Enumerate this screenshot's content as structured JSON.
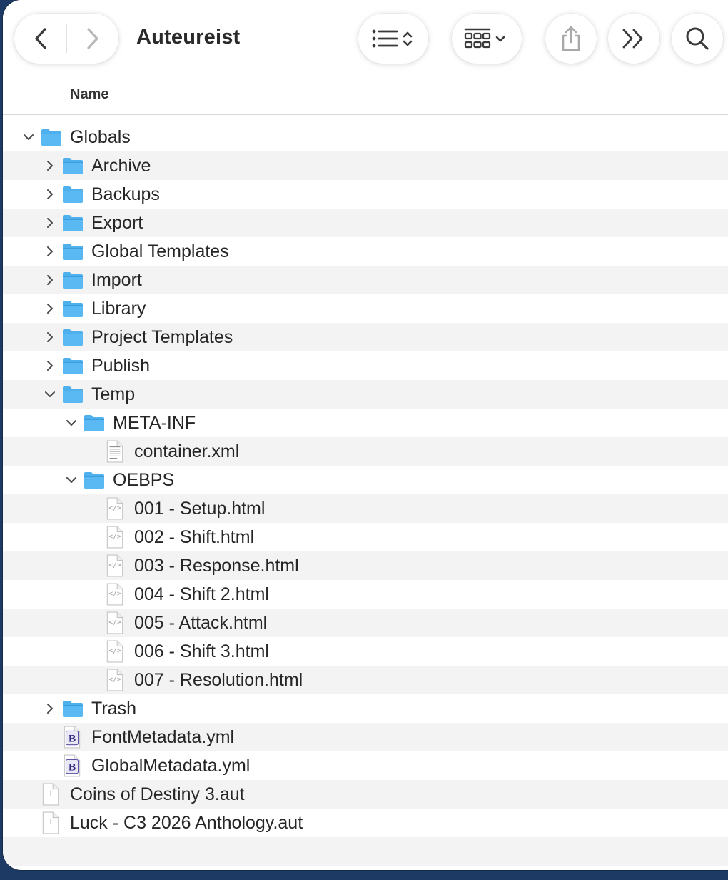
{
  "window": {
    "title": "Auteureist",
    "accent_folder": "#4fb0ee"
  },
  "toolbar": {
    "back_icon": "chevron-left-icon",
    "forward_icon": "chevron-right-icon",
    "view_icon": "list-view-icon",
    "group_icon": "grid-group-icon",
    "share_icon": "share-icon",
    "more_icon": "double-chevron-right-icon",
    "search_icon": "search-icon"
  },
  "columns": {
    "name": "Name"
  },
  "rows": [
    {
      "name": "Globals",
      "depth": 0,
      "kind": "folder",
      "expanded": true
    },
    {
      "name": "Archive",
      "depth": 1,
      "kind": "folder",
      "expanded": false
    },
    {
      "name": "Backups",
      "depth": 1,
      "kind": "folder",
      "expanded": false
    },
    {
      "name": "Export",
      "depth": 1,
      "kind": "folder",
      "expanded": false
    },
    {
      "name": "Global Templates",
      "depth": 1,
      "kind": "folder",
      "expanded": false
    },
    {
      "name": "Import",
      "depth": 1,
      "kind": "folder",
      "expanded": false
    },
    {
      "name": "Library",
      "depth": 1,
      "kind": "folder",
      "expanded": false
    },
    {
      "name": "Project Templates",
      "depth": 1,
      "kind": "folder",
      "expanded": false
    },
    {
      "name": "Publish",
      "depth": 1,
      "kind": "folder",
      "expanded": false
    },
    {
      "name": "Temp",
      "depth": 1,
      "kind": "folder",
      "expanded": true
    },
    {
      "name": "META-INF",
      "depth": 2,
      "kind": "folder",
      "expanded": true
    },
    {
      "name": "container.xml",
      "depth": 3,
      "kind": "xml"
    },
    {
      "name": "OEBPS",
      "depth": 2,
      "kind": "folder",
      "expanded": true
    },
    {
      "name": "001 - Setup.html",
      "depth": 3,
      "kind": "html"
    },
    {
      "name": "002 - Shift.html",
      "depth": 3,
      "kind": "html"
    },
    {
      "name": "003 - Response.html",
      "depth": 3,
      "kind": "html"
    },
    {
      "name": "004 - Shift 2.html",
      "depth": 3,
      "kind": "html"
    },
    {
      "name": "005 - Attack.html",
      "depth": 3,
      "kind": "html"
    },
    {
      "name": "006 - Shift 3.html",
      "depth": 3,
      "kind": "html"
    },
    {
      "name": "007 - Resolution.html",
      "depth": 3,
      "kind": "html"
    },
    {
      "name": "Trash",
      "depth": 1,
      "kind": "folder",
      "expanded": false
    },
    {
      "name": "FontMetadata.yml",
      "depth": 1,
      "kind": "yml"
    },
    {
      "name": "GlobalMetadata.yml",
      "depth": 1,
      "kind": "yml"
    },
    {
      "name": "Coins of Destiny 3.aut",
      "depth": 0,
      "kind": "doc"
    },
    {
      "name": "Luck - C3 2026 Anthology.aut",
      "depth": 0,
      "kind": "doc"
    }
  ]
}
